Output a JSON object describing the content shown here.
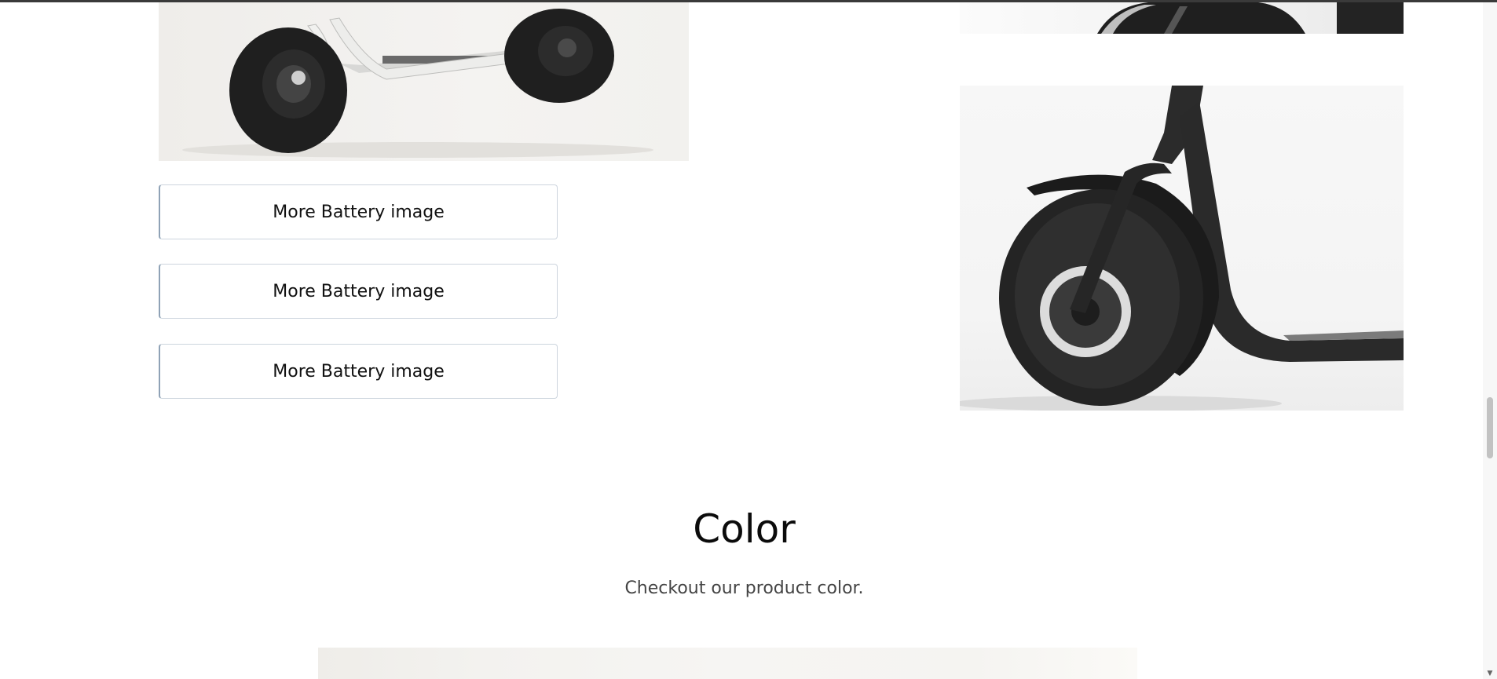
{
  "gallery": {
    "buttons": [
      {
        "label": "More Battery image"
      },
      {
        "label": "More Battery image"
      },
      {
        "label": "More Battery image"
      }
    ],
    "images": [
      {
        "alt": "scooter-side-view"
      },
      {
        "alt": "scooter-rear-wheel"
      },
      {
        "alt": "scooter-front-wheel"
      }
    ]
  },
  "color_section": {
    "title": "Color",
    "subtitle": "Checkout our product color."
  },
  "colors": {
    "tire": "#1f1f1f",
    "frame_white": "#e8e8e6",
    "frame_dark": "#2b2b2b",
    "button_border": "#cdd5de"
  }
}
